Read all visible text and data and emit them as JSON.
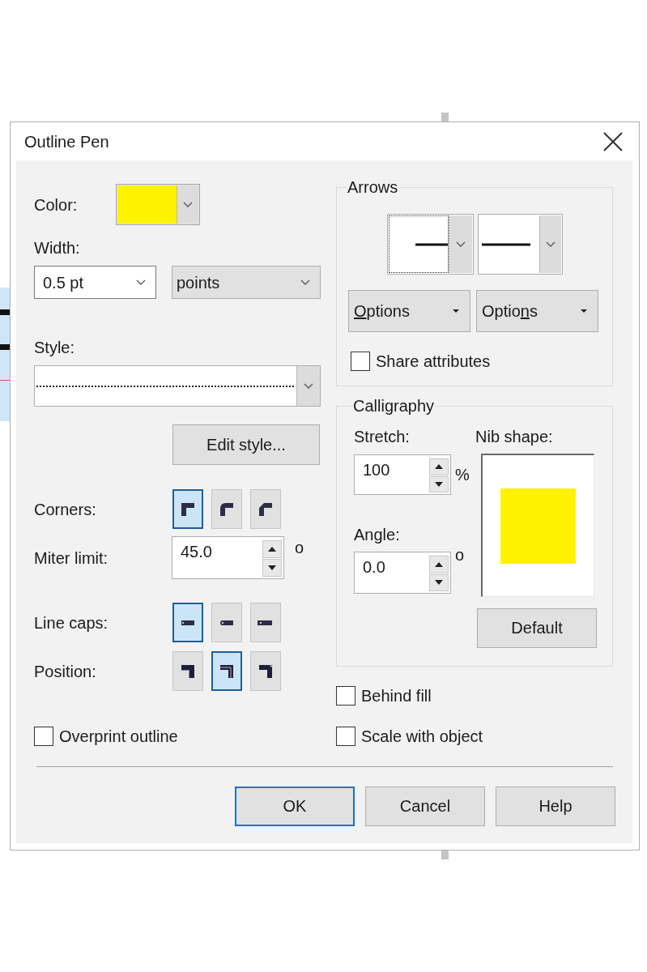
{
  "window": {
    "title": "Outline Pen"
  },
  "pen_color": {
    "label": "Color:",
    "color": "#fff200"
  },
  "width": {
    "label": "Width:",
    "value": "0.5 pt",
    "units": "points"
  },
  "style": {
    "label": "Style:",
    "kind": "dotted",
    "edit_button": "Edit style..."
  },
  "corners": {
    "label": "Corners:",
    "options": [
      {
        "kind": "miter",
        "selected": true
      },
      {
        "kind": "round",
        "selected": false
      },
      {
        "kind": "bevel",
        "selected": false
      }
    ]
  },
  "miter_limit": {
    "label": "Miter limit:",
    "value": "45.0",
    "unit": "o"
  },
  "line_caps": {
    "label": "Line caps:",
    "options": [
      {
        "kind": "butt",
        "selected": true
      },
      {
        "kind": "round",
        "selected": false
      },
      {
        "kind": "square",
        "selected": false
      }
    ]
  },
  "position": {
    "label": "Position:",
    "options": [
      {
        "kind": "outside",
        "selected": false
      },
      {
        "kind": "center",
        "selected": true
      },
      {
        "kind": "inside",
        "selected": false
      }
    ]
  },
  "overprint_outline": {
    "label": "Overprint outline",
    "checked": false
  },
  "arrows": {
    "title": "Arrows",
    "start": {
      "kind": "plain-line",
      "focused": true
    },
    "end": {
      "kind": "plain-line",
      "focused": false
    },
    "options_buttons": [
      {
        "label": [
          {
            "text": "O",
            "underlined": true
          },
          {
            "text": "ptions",
            "underlined": false
          }
        ]
      },
      {
        "label": [
          {
            "text": "Optio",
            "underlined": false
          },
          {
            "text": "n",
            "underlined": true
          },
          {
            "text": "s",
            "underlined": false
          }
        ]
      }
    ],
    "share_attributes": {
      "label": "Share attributes",
      "checked": false
    }
  },
  "calligraphy": {
    "title": "Calligraphy",
    "stretch": {
      "label": "Stretch:",
      "value": "100",
      "unit": "%"
    },
    "angle": {
      "label": "Angle:",
      "value": "0.0",
      "unit": "o"
    },
    "nib_shape": {
      "label": "Nib shape:",
      "kind": "square"
    },
    "default_button": "Default"
  },
  "behind_fill": {
    "label": "Behind fill",
    "checked": false
  },
  "scale_with_object": {
    "label": "Scale with object",
    "checked": false
  },
  "buttons": [
    {
      "label": "OK",
      "default": true
    },
    {
      "label": "Cancel",
      "default": false
    },
    {
      "label": "Help",
      "default": false
    }
  ]
}
